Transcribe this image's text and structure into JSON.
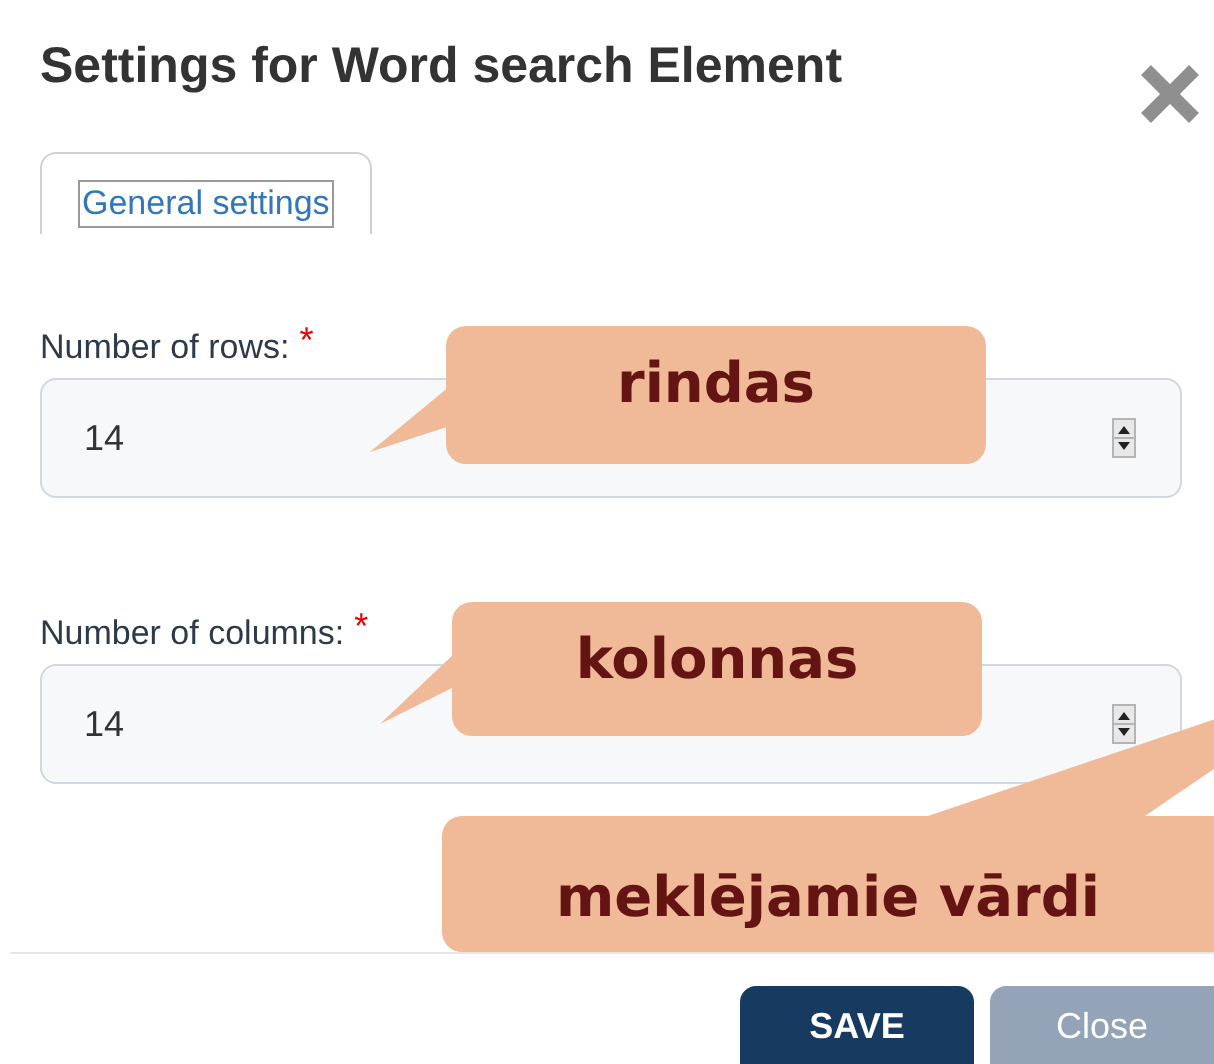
{
  "dialog": {
    "title": "Settings for Word search Element"
  },
  "tabs": [
    {
      "label": "General settings",
      "selected": true
    }
  ],
  "fields": [
    {
      "label": "Number of rows:",
      "required": true,
      "value": "14"
    },
    {
      "label": "Number of columns:",
      "required": true,
      "value": "14"
    }
  ],
  "required_mark": "*",
  "buttons": [
    {
      "label": "SAVE",
      "kind": "primary"
    },
    {
      "label": "Close",
      "kind": "secondary"
    }
  ],
  "callouts": [
    "rindas",
    "kolonnas",
    "meklējamie vārdi"
  ]
}
